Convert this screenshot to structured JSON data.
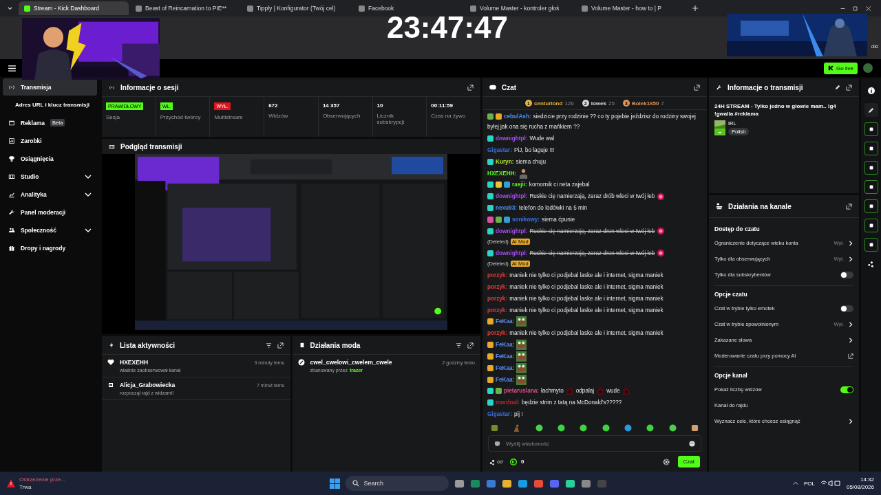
{
  "browser": {
    "tabs": [
      {
        "title": "Stream - Kick Dashboard",
        "selected": true
      },
      {
        "title": "Beast of Reincarnation to PIE**",
        "selected": false
      },
      {
        "title": "Tipply | Konfigurator (Twój cel)",
        "selected": false
      },
      {
        "title": "Facebook",
        "selected": false
      },
      {
        "title": "Volume Master - kontroler głoś",
        "selected": false
      },
      {
        "title": "Volume Master - how to | P",
        "selected": false
      }
    ],
    "bookmarks_fragment": "dki"
  },
  "overlay": {
    "clock": "23:47:47"
  },
  "header": {
    "go_live": "Go live"
  },
  "sidebar": {
    "items": [
      {
        "label": "Transmisja",
        "kind": "main",
        "selected": true
      },
      {
        "label": "Adres URL i klucz transmisji",
        "kind": "sub",
        "selected": false
      },
      {
        "label": "Reklama",
        "kind": "main",
        "selected": false,
        "badge": "Beta"
      },
      {
        "label": "Zarobki",
        "kind": "main",
        "selected": false
      },
      {
        "label": "Osiągnięcia",
        "kind": "main",
        "selected": false
      },
      {
        "label": "Studio",
        "kind": "group",
        "selected": false
      },
      {
        "label": "Analityka",
        "kind": "group",
        "selected": false
      },
      {
        "label": "Panel moderacji",
        "kind": "main",
        "selected": false
      },
      {
        "label": "Społeczność",
        "kind": "group",
        "selected": false
      },
      {
        "label": "Dropy i nagrody",
        "kind": "main",
        "selected": false
      }
    ]
  },
  "session": {
    "title": "Informacje o sesji",
    "stats": [
      {
        "kind": "badge",
        "value": "PRAWIDŁOWY",
        "label": "Sesja",
        "color": "#53fc18"
      },
      {
        "kind": "badge",
        "value": "WŁ.",
        "label": "Przychód twórcy",
        "color": "#53fc18"
      },
      {
        "kind": "badge",
        "value": "WYŁ.",
        "label": "Multistream",
        "color": "#e0141e"
      },
      {
        "kind": "number",
        "value": "672",
        "label": "Widzów"
      },
      {
        "kind": "number",
        "value": "14 357",
        "label": "Obserwujących"
      },
      {
        "kind": "number",
        "value": "10",
        "label": "Licznik subskrypcji"
      },
      {
        "kind": "number",
        "value": "00:11:59",
        "label": "Czas na żywo"
      }
    ]
  },
  "preview": {
    "title": "Podgląd transmisji",
    "kind": "picture"
  },
  "activity": {
    "title": "Lista aktywności",
    "items": [
      {
        "kind": "follow",
        "name": "HXEXEHH",
        "time": "3 minuty temu",
        "text": "właśnie zaobserwował kanał"
      },
      {
        "kind": "raid",
        "name": "Alicja_Grabowiecka",
        "time": "7 minut temu",
        "text": "rozpoczął rajd z widzami!"
      }
    ]
  },
  "mod_actions": {
    "title": "Działania moda",
    "items": [
      {
        "kind": "ban",
        "name": "cwel_cwelowi_cwelem_cwele",
        "time": "2 godziny temu",
        "text": "zbanowany przez",
        "moderator": "trazer"
      }
    ]
  },
  "chat": {
    "title": "Czat",
    "leaders": [
      {
        "rank": "1",
        "name": "centuriond",
        "count": "126",
        "color": "#e8b53c"
      },
      {
        "rank": "2",
        "name": "lowek",
        "count": "25",
        "color": "#d8d8d8"
      },
      {
        "rank": "3",
        "name": "Bolek1650",
        "count": "7",
        "color": "#e0945a"
      }
    ],
    "messages": [
      {
        "user": "cebulAsh:",
        "color": "#4a8ff0",
        "badges": [
          {
            "kind": "gem"
          },
          {
            "kind": "crown"
          }
        ],
        "parts": [
          {
            "kind": "text",
            "text": "siedzicie przy rodzinie ?? co ty pojebie jeździsz do rodziny swojej"
          },
          {
            "kind": "text",
            "text": "byłej jak ona się rucha z mańkiem ??"
          }
        ],
        "deleted": false
      },
      {
        "user": "downightpl:",
        "color": "#a64ff0",
        "badges": [
          {
            "kind": "sub"
          }
        ],
        "parts": [
          {
            "kind": "text",
            "text": "Wude wal"
          }
        ],
        "deleted": false
      },
      {
        "user": "Gigastar:",
        "color": "#3c6fe0",
        "parts": [
          {
            "kind": "text",
            "text": "PiJ, bo laguje !!!"
          }
        ],
        "deleted": false
      },
      {
        "user": "Kuryn:",
        "color": "#b8e83a",
        "badges": [
          {
            "kind": "sub"
          }
        ],
        "parts": [
          {
            "kind": "text",
            "text": "siema chuju"
          }
        ],
        "deleted": false
      },
      {
        "user": "HXEXEHH:",
        "color": "#53fc18",
        "parts": [
          {
            "kind": "figure"
          }
        ],
        "deleted": false
      },
      {
        "user": "rasjii:",
        "color": "#53fc18",
        "badges": [
          {
            "kind": "sub"
          },
          {
            "kind": "gift"
          },
          {
            "kind": "mod"
          }
        ],
        "parts": [
          {
            "kind": "text",
            "text": "komornik ci neta zajebal"
          }
        ],
        "deleted": false
      },
      {
        "user": "downightpl:",
        "color": "#a64ff0",
        "badges": [
          {
            "kind": "sub"
          }
        ],
        "parts": [
          {
            "kind": "text",
            "text": "Ruskie cię namierzają, zaraz drób wleci w twój łeb"
          },
          {
            "kind": "glow"
          }
        ],
        "deleted": false
      },
      {
        "user": "nexu93:",
        "color": "#4a8ff0",
        "badges": [
          {
            "kind": "sub"
          }
        ],
        "parts": [
          {
            "kind": "text",
            "text": "telefon do lodówki na 5 min"
          }
        ],
        "deleted": false
      },
      {
        "user": "sonikowy:",
        "color": "#3c6fe0",
        "badges": [
          {
            "kind": "pink"
          },
          {
            "kind": "gem"
          },
          {
            "kind": "mod"
          }
        ],
        "parts": [
          {
            "kind": "text",
            "text": "siema ćpunie"
          }
        ],
        "deleted": false
      },
      {
        "user": "downightpl:",
        "color": "#a64ff0",
        "badges": [
          {
            "kind": "sub"
          }
        ],
        "parts": [
          {
            "kind": "text",
            "text": "Ruskie cię namierzają, zaraz dron wleci w twój łeb"
          },
          {
            "kind": "glow"
          }
        ],
        "deleted": true,
        "deleted_label": "(Deleted)",
        "mod_tag": "AI Mod"
      },
      {
        "user": "downightpl:",
        "color": "#a64ff0",
        "badges": [
          {
            "kind": "sub"
          }
        ],
        "parts": [
          {
            "kind": "text",
            "text": "Ruskie cię namierzają, zaraz dron wleci w twój łeb"
          },
          {
            "kind": "glow"
          }
        ],
        "deleted": true,
        "deleted_label": "(Deleted)",
        "mod_tag": "AI Mod"
      },
      {
        "user": "porzyk:",
        "color": "#e03c3c",
        "parts": [
          {
            "kind": "text",
            "text": "maniek nie tylko ci podjebal laske ale i internet, sigma maniek"
          }
        ],
        "deleted": false
      },
      {
        "user": "porzyk:",
        "color": "#e03c3c",
        "parts": [
          {
            "kind": "text",
            "text": "maniek nie tylko ci podjebal laske ale i internet, sigma maniek"
          }
        ],
        "deleted": false
      },
      {
        "user": "porzyk:",
        "color": "#e03c3c",
        "parts": [
          {
            "kind": "text",
            "text": "maniek nie tylko ci podjebal laske ale i internet, sigma maniek"
          }
        ],
        "deleted": false
      },
      {
        "user": "porzyk:",
        "color": "#e03c3c",
        "parts": [
          {
            "kind": "text",
            "text": "maniek nie tylko ci podjebal laske ale i internet, sigma maniek"
          }
        ],
        "deleted": false
      },
      {
        "user": "FeKaa:",
        "color": "#5b8def",
        "badges": [
          {
            "kind": "crown"
          }
        ],
        "parts": [
          {
            "kind": "frog"
          }
        ],
        "deleted": false
      },
      {
        "user": "porzyk:",
        "color": "#e03c3c",
        "parts": [
          {
            "kind": "text",
            "text": "maniek nie tylko ci podjebal laske ale i internet, sigma maniek"
          }
        ],
        "deleted": false
      },
      {
        "user": "FeKaa:",
        "color": "#5b8def",
        "badges": [
          {
            "kind": "crown"
          }
        ],
        "parts": [
          {
            "kind": "frog"
          }
        ],
        "deleted": false
      },
      {
        "user": "FeKaa:",
        "color": "#5b8def",
        "badges": [
          {
            "kind": "crown"
          }
        ],
        "parts": [
          {
            "kind": "frog"
          }
        ],
        "deleted": false
      },
      {
        "user": "FeKaa:",
        "color": "#5b8def",
        "badges": [
          {
            "kind": "crown"
          }
        ],
        "parts": [
          {
            "kind": "frog"
          }
        ],
        "deleted": false
      },
      {
        "user": "FeKaa:",
        "color": "#5b8def",
        "badges": [
          {
            "kind": "crown"
          }
        ],
        "parts": [
          {
            "kind": "frog"
          }
        ],
        "deleted": false
      },
      {
        "user": "pietaruslana:",
        "color": "#e0508a",
        "badges": [
          {
            "kind": "sub"
          },
          {
            "kind": "gem"
          }
        ],
        "parts": [
          {
            "kind": "text",
            "text": "łachmyto"
          },
          {
            "kind": "dark"
          },
          {
            "kind": "text",
            "text": "odpalaj"
          },
          {
            "kind": "dark"
          },
          {
            "kind": "text",
            "text": "wude"
          },
          {
            "kind": "dark"
          }
        ],
        "deleted": false
      },
      {
        "user": "mordoal:",
        "color": "#c0282e",
        "badges": [
          {
            "kind": "sub"
          }
        ],
        "parts": [
          {
            "kind": "text",
            "text": "będzie strim z tatą na McDonald's?????"
          }
        ],
        "deleted": false
      },
      {
        "user": "Gigastar:",
        "color": "#3c6fe0",
        "parts": [
          {
            "kind": "text",
            "text": "pij !"
          }
        ],
        "deleted": false
      }
    ],
    "emote_bar": [
      {
        "kind": "ogre"
      },
      {
        "kind": "figure"
      },
      {
        "kind": "ghost"
      },
      {
        "kind": "blob"
      },
      {
        "kind": "blob"
      },
      {
        "kind": "blob"
      },
      {
        "kind": "globe"
      },
      {
        "kind": "blob"
      },
      {
        "kind": "ghost"
      },
      {
        "kind": "box"
      }
    ],
    "input": {
      "placeholder": "Wyślij wiadomość"
    },
    "points": "0",
    "send": "Czat"
  },
  "stream_info": {
    "title": "Informacje o transmisji",
    "stream_title": "24H STREAM - Tylko jedno w głowie mam.. !g4 !gwalia #reklama",
    "category": "IRL",
    "tag": "Polish"
  },
  "channel_actions": {
    "title": "Działania na kanale",
    "sections": [
      {
        "heading": "Dostęp do czatu",
        "rows": [
          {
            "kind": "link",
            "label": "Ograniczenie dotyczące wieku konta",
            "value": "Wył."
          },
          {
            "kind": "link",
            "label": "Tylko dla obserwujących",
            "value": "Wył."
          },
          {
            "kind": "toggle",
            "label": "Tylko dla subskrybentów",
            "on": false
          }
        ]
      },
      {
        "heading": "Opcje czatu",
        "rows": [
          {
            "kind": "toggle",
            "label": "Czat w trybie tylko emotek",
            "on": false
          },
          {
            "kind": "link",
            "label": "Czat w trybie spowolnionym",
            "value": "Wył."
          },
          {
            "kind": "link",
            "label": "Zakazane słowa"
          },
          {
            "kind": "external",
            "label": "Moderowanie czatu przy pomocy AI"
          }
        ]
      },
      {
        "heading": "Opcje kanał",
        "rows": [
          {
            "kind": "toggle",
            "label": "Pokaż liczbę widzów",
            "on": true
          },
          {
            "kind": "plain",
            "label": "Kanał do rajdu"
          },
          {
            "kind": "link",
            "label": "Wyznacz cele, które chcesz osiągnąć"
          }
        ]
      }
    ]
  },
  "taskbar": {
    "notification": {
      "title": "Ostrzeżenie prze...",
      "status": "Trwa"
    },
    "search": {
      "placeholder": "Search"
    },
    "language": "POL",
    "time": "14:32",
    "date": "05/08/2026"
  }
}
